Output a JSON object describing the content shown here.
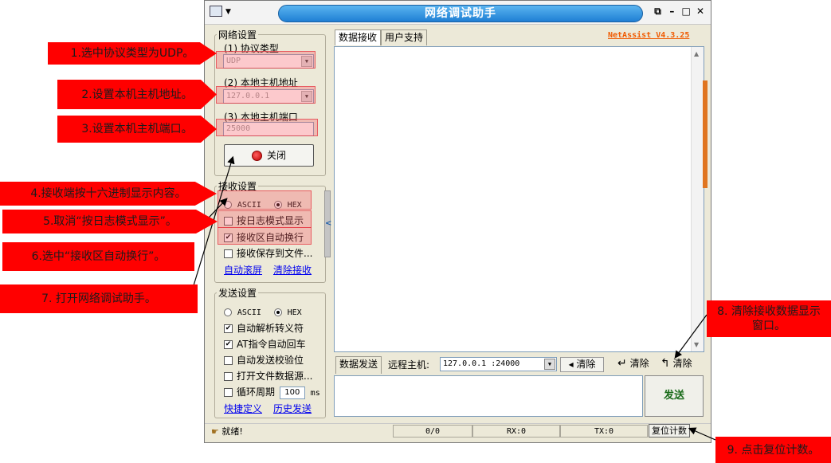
{
  "window": {
    "title": "网络调试助手",
    "version": "NetAssist V4.3.25",
    "win_buttons": [
      "⧉",
      "–",
      "□",
      "✕"
    ]
  },
  "network_settings": {
    "legend": "网络设置",
    "protocol_label": "(1) 协议类型",
    "protocol_value": "UDP",
    "host_label": "(2) 本地主机地址",
    "host_value": "127.0.0.1",
    "port_label": "(3) 本地主机端口",
    "port_value": "25000",
    "close_button": "关闭"
  },
  "receive_settings": {
    "legend": "接收设置",
    "radio_ascii": "ASCII",
    "radio_hex": "HEX",
    "selected": "HEX",
    "log_mode": {
      "label": "按日志模式显示",
      "checked": false
    },
    "auto_wrap": {
      "label": "接收区自动换行",
      "checked": true
    },
    "save_file": {
      "label": "接收保存到文件...",
      "checked": false
    },
    "link_autoscroll": "自动滚屏",
    "link_clear": "清除接收"
  },
  "send_settings": {
    "legend": "发送设置",
    "radio_ascii": "ASCII",
    "radio_hex": "HEX",
    "selected": "HEX",
    "escape": {
      "label": "自动解析转义符",
      "checked": true
    },
    "at_cr": {
      "label": "AT指令自动回车",
      "checked": true
    },
    "checksum": {
      "label": "自动发送校验位",
      "checked": false
    },
    "file_source": {
      "label": "打开文件数据源...",
      "checked": false
    },
    "cycle": {
      "label": "循环周期",
      "checked": false,
      "value": "100",
      "unit": "ms"
    },
    "link_shortcut": "快捷定义",
    "link_history": "历史发送"
  },
  "receive_tabs": [
    "数据接收",
    "用户支持"
  ],
  "send_bar": {
    "tab": "数据发送",
    "remote_label": "远程主机:",
    "remote_value": "127.0.0.1 :24000",
    "clear1": "清除",
    "clear2": "清除",
    "clear3": "清除",
    "send_button": "发送"
  },
  "status": {
    "ready": "就绪!",
    "count": "0/0",
    "rx": "RX:0",
    "tx": "TX:0",
    "reset": "复位计数"
  },
  "callouts": {
    "c1": "1.选中协议类型为UDP。",
    "c2": "2.设置本机主机地址。",
    "c3": "3.设置本机主机端口。",
    "c4": "4.接收端按十六进制显示内容。",
    "c5": "5.取消“按日志模式显示”。",
    "c6": "6.选中“接收区自动换行”。",
    "c7": "7. 打开网络调试助手。",
    "c8_line1": "8. 清除接收数据显示",
    "c8_line2": "窗口。",
    "c9": "9. 点击复位计数。"
  },
  "colors": {
    "callout": "#ff0000",
    "title_bar": "#1f7fd4",
    "version": "#f05a00",
    "send_button_text": "#1a6b1a"
  }
}
